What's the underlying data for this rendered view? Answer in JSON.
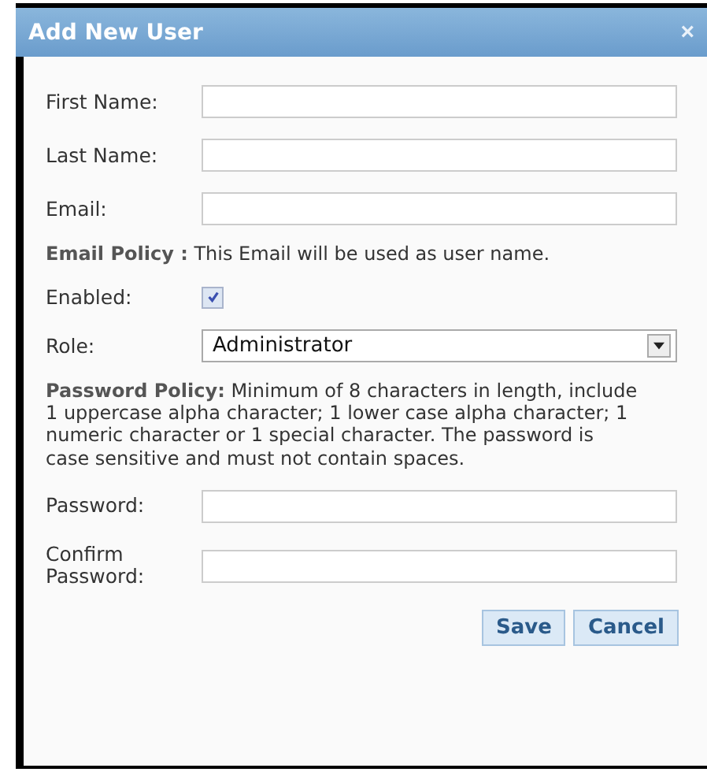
{
  "window": {
    "title": "Add New User",
    "close": "×"
  },
  "rows": [
    {
      "kind": "text",
      "label": "First Name:"
    },
    {
      "kind": "text",
      "label": "Last Name:"
    },
    {
      "kind": "text",
      "label": "Email:"
    },
    {
      "kind": "note",
      "text": "**Email Policy :** This Email will be used as user name."
    },
    {
      "kind": "checkbox",
      "label": "Enabled:",
      "checked": true
    },
    {
      "kind": "select",
      "label": "Role:",
      "value": "Administrator"
    },
    {
      "kind": "note",
      "text": "**Password Policy:** Minimum of 8 characters in length, include 1 uppercase alpha character; 1 lower case alpha character; 1 numeric character or 1 special character. The password is case sensitive and must not contain spaces."
    },
    {
      "kind": "password",
      "label": "Password:"
    },
    {
      "kind": "password",
      "label": "Confirm Password:"
    }
  ],
  "buttons": [
    "Save",
    "Cancel"
  ]
}
